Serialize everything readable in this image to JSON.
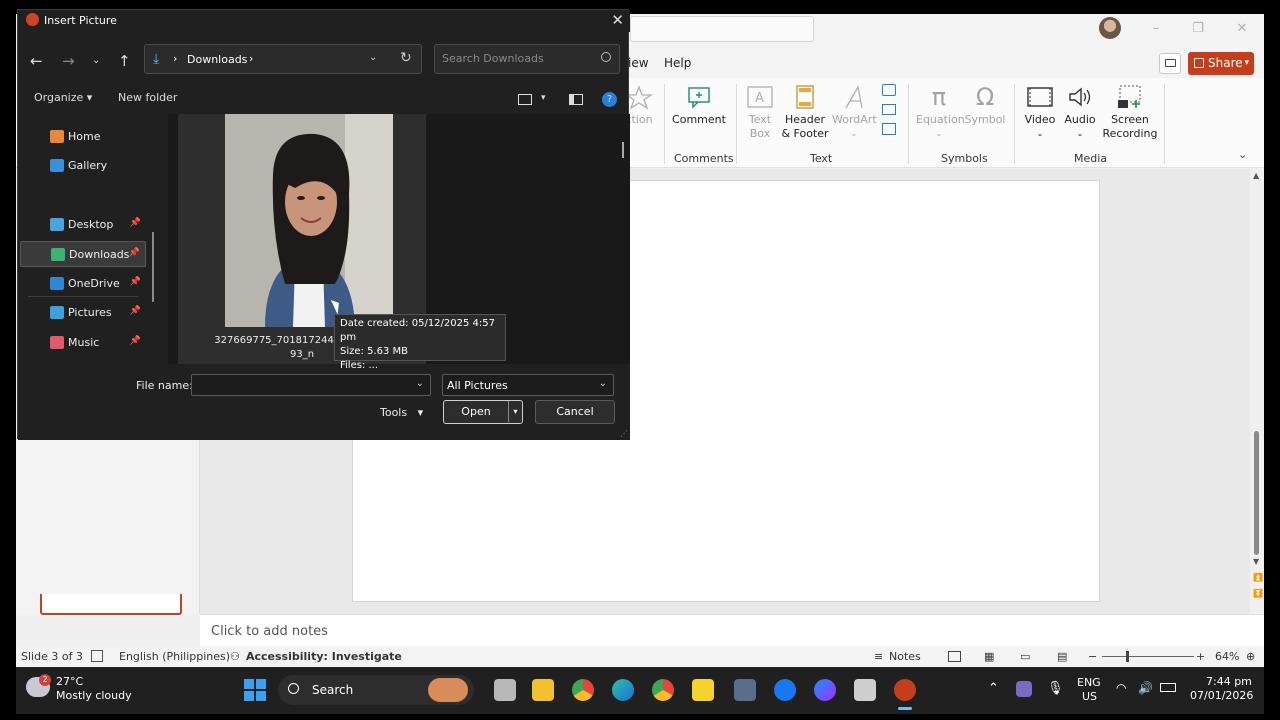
{
  "ppt": {
    "menu": {
      "view": "iew",
      "help": "Help"
    },
    "share": "Share",
    "ribbon": {
      "section": "ction",
      "comment": "Comment",
      "text_box_1": "Text",
      "text_box_2": "Box",
      "header_1": "Header",
      "header_2": "& Footer",
      "wordart": "WordArt",
      "equation": "Equation",
      "symbol": "Symbol",
      "video": "Video",
      "audio": "Audio",
      "screen_1": "Screen",
      "screen_2": "Recording",
      "groups": {
        "comments": "Comments",
        "text": "Text",
        "symbols": "Symbols",
        "media": "Media"
      }
    },
    "notes_placeholder": "Click to add notes",
    "status": {
      "slide": "Slide 3 of 3",
      "language": "English (Philippines)",
      "accessibility": "Accessibility: Investigate",
      "notes": "Notes",
      "zoom": "64%"
    }
  },
  "dialog": {
    "title": "Insert Picture",
    "address": "Downloads",
    "search_placeholder": "Search Downloads",
    "organize": "Organize",
    "new_folder": "New folder",
    "nav": [
      {
        "label": "Home",
        "color": "#e8883a"
      },
      {
        "label": "Gallery",
        "color": "#3a8fd8"
      },
      {
        "label": "Desktop",
        "color": "#4aa3df"
      },
      {
        "label": "Downloads",
        "color": "#3cb371"
      },
      {
        "label": "OneDrive",
        "color": "#2f86d6"
      },
      {
        "label": "Pictures",
        "color": "#3fa0e0"
      },
      {
        "label": "Music",
        "color": "#e05a6a"
      }
    ],
    "file": {
      "name_1": "327669775_701817244927037_49",
      "name_2": "93_n"
    },
    "tooltip": {
      "date": "Date created: 05/12/2025 4:57 pm",
      "size": "Size: 5.63 MB",
      "files": "Files: ..."
    },
    "file_name_label": "File name:",
    "file_name_value": "",
    "filter": "All Pictures",
    "tools": "Tools",
    "open": "Open",
    "cancel": "Cancel"
  },
  "taskbar": {
    "weather_temp": "27°C",
    "weather_desc": "Mostly cloudy",
    "weather_badge": "2",
    "search": "Search",
    "lang_1": "ENG",
    "lang_2": "US",
    "time": "7:44 pm",
    "date": "07/01/2026"
  }
}
